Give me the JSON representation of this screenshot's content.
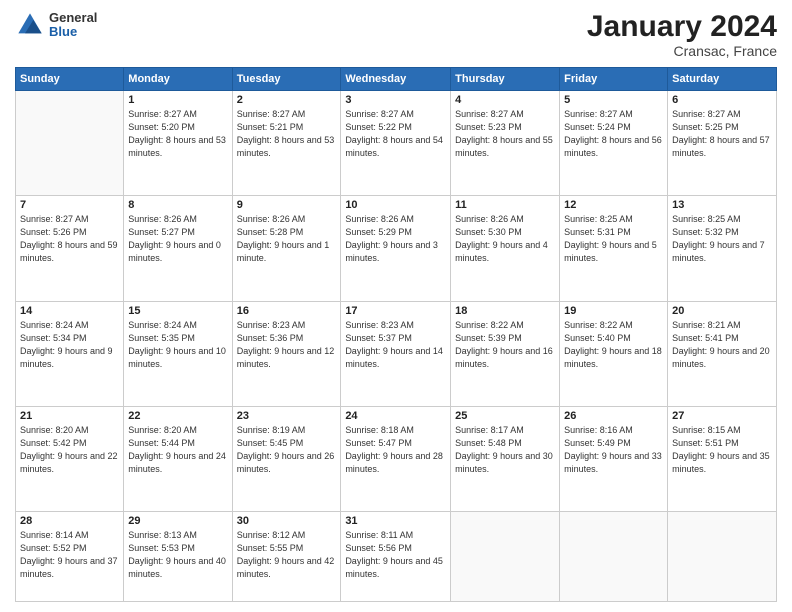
{
  "header": {
    "logo": {
      "general": "General",
      "blue": "Blue"
    },
    "title": "January 2024",
    "location": "Cransac, France"
  },
  "days_of_week": [
    "Sunday",
    "Monday",
    "Tuesday",
    "Wednesday",
    "Thursday",
    "Friday",
    "Saturday"
  ],
  "weeks": [
    [
      {
        "day": "",
        "sunrise": "",
        "sunset": "",
        "daylight": ""
      },
      {
        "day": "1",
        "sunrise": "8:27 AM",
        "sunset": "5:20 PM",
        "daylight": "8 hours and 53 minutes."
      },
      {
        "day": "2",
        "sunrise": "8:27 AM",
        "sunset": "5:21 PM",
        "daylight": "8 hours and 53 minutes."
      },
      {
        "day": "3",
        "sunrise": "8:27 AM",
        "sunset": "5:22 PM",
        "daylight": "8 hours and 54 minutes."
      },
      {
        "day": "4",
        "sunrise": "8:27 AM",
        "sunset": "5:23 PM",
        "daylight": "8 hours and 55 minutes."
      },
      {
        "day": "5",
        "sunrise": "8:27 AM",
        "sunset": "5:24 PM",
        "daylight": "8 hours and 56 minutes."
      },
      {
        "day": "6",
        "sunrise": "8:27 AM",
        "sunset": "5:25 PM",
        "daylight": "8 hours and 57 minutes."
      }
    ],
    [
      {
        "day": "7",
        "sunrise": "8:27 AM",
        "sunset": "5:26 PM",
        "daylight": "8 hours and 59 minutes."
      },
      {
        "day": "8",
        "sunrise": "8:26 AM",
        "sunset": "5:27 PM",
        "daylight": "9 hours and 0 minutes."
      },
      {
        "day": "9",
        "sunrise": "8:26 AM",
        "sunset": "5:28 PM",
        "daylight": "9 hours and 1 minute."
      },
      {
        "day": "10",
        "sunrise": "8:26 AM",
        "sunset": "5:29 PM",
        "daylight": "9 hours and 3 minutes."
      },
      {
        "day": "11",
        "sunrise": "8:26 AM",
        "sunset": "5:30 PM",
        "daylight": "9 hours and 4 minutes."
      },
      {
        "day": "12",
        "sunrise": "8:25 AM",
        "sunset": "5:31 PM",
        "daylight": "9 hours and 5 minutes."
      },
      {
        "day": "13",
        "sunrise": "8:25 AM",
        "sunset": "5:32 PM",
        "daylight": "9 hours and 7 minutes."
      }
    ],
    [
      {
        "day": "14",
        "sunrise": "8:24 AM",
        "sunset": "5:34 PM",
        "daylight": "9 hours and 9 minutes."
      },
      {
        "day": "15",
        "sunrise": "8:24 AM",
        "sunset": "5:35 PM",
        "daylight": "9 hours and 10 minutes."
      },
      {
        "day": "16",
        "sunrise": "8:23 AM",
        "sunset": "5:36 PM",
        "daylight": "9 hours and 12 minutes."
      },
      {
        "day": "17",
        "sunrise": "8:23 AM",
        "sunset": "5:37 PM",
        "daylight": "9 hours and 14 minutes."
      },
      {
        "day": "18",
        "sunrise": "8:22 AM",
        "sunset": "5:39 PM",
        "daylight": "9 hours and 16 minutes."
      },
      {
        "day": "19",
        "sunrise": "8:22 AM",
        "sunset": "5:40 PM",
        "daylight": "9 hours and 18 minutes."
      },
      {
        "day": "20",
        "sunrise": "8:21 AM",
        "sunset": "5:41 PM",
        "daylight": "9 hours and 20 minutes."
      }
    ],
    [
      {
        "day": "21",
        "sunrise": "8:20 AM",
        "sunset": "5:42 PM",
        "daylight": "9 hours and 22 minutes."
      },
      {
        "day": "22",
        "sunrise": "8:20 AM",
        "sunset": "5:44 PM",
        "daylight": "9 hours and 24 minutes."
      },
      {
        "day": "23",
        "sunrise": "8:19 AM",
        "sunset": "5:45 PM",
        "daylight": "9 hours and 26 minutes."
      },
      {
        "day": "24",
        "sunrise": "8:18 AM",
        "sunset": "5:47 PM",
        "daylight": "9 hours and 28 minutes."
      },
      {
        "day": "25",
        "sunrise": "8:17 AM",
        "sunset": "5:48 PM",
        "daylight": "9 hours and 30 minutes."
      },
      {
        "day": "26",
        "sunrise": "8:16 AM",
        "sunset": "5:49 PM",
        "daylight": "9 hours and 33 minutes."
      },
      {
        "day": "27",
        "sunrise": "8:15 AM",
        "sunset": "5:51 PM",
        "daylight": "9 hours and 35 minutes."
      }
    ],
    [
      {
        "day": "28",
        "sunrise": "8:14 AM",
        "sunset": "5:52 PM",
        "daylight": "9 hours and 37 minutes."
      },
      {
        "day": "29",
        "sunrise": "8:13 AM",
        "sunset": "5:53 PM",
        "daylight": "9 hours and 40 minutes."
      },
      {
        "day": "30",
        "sunrise": "8:12 AM",
        "sunset": "5:55 PM",
        "daylight": "9 hours and 42 minutes."
      },
      {
        "day": "31",
        "sunrise": "8:11 AM",
        "sunset": "5:56 PM",
        "daylight": "9 hours and 45 minutes."
      },
      {
        "day": "",
        "sunrise": "",
        "sunset": "",
        "daylight": ""
      },
      {
        "day": "",
        "sunrise": "",
        "sunset": "",
        "daylight": ""
      },
      {
        "day": "",
        "sunrise": "",
        "sunset": "",
        "daylight": ""
      }
    ]
  ]
}
